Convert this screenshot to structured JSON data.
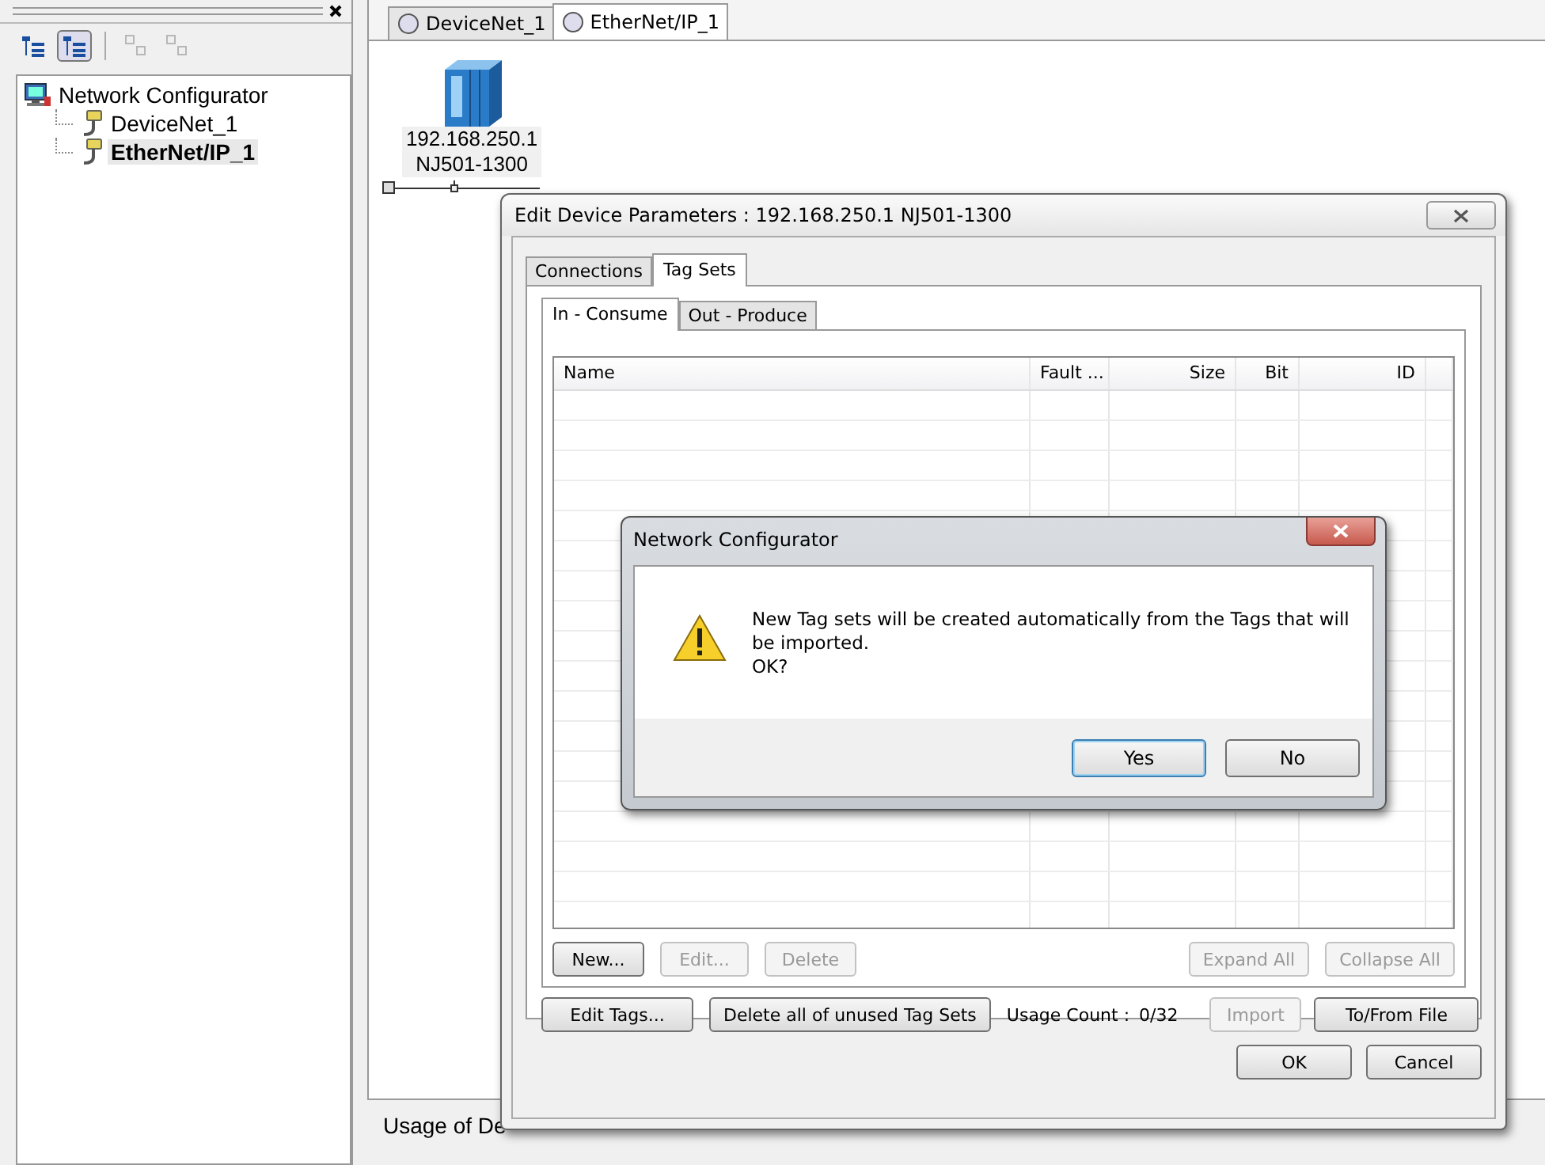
{
  "sidebar": {
    "toolbar": [
      {
        "kind": "tree",
        "pressed": false,
        "disabled": false
      },
      {
        "kind": "tree",
        "pressed": true,
        "disabled": false
      },
      {
        "kind": "expand",
        "pressed": false,
        "disabled": true
      },
      {
        "kind": "collapse",
        "pressed": false,
        "disabled": true
      }
    ],
    "tree": [
      {
        "label": "Network Configurator",
        "kind": "pc",
        "selected": false,
        "children": [
          {
            "label": "DeviceNet_1",
            "kind": "network",
            "selected": false
          },
          {
            "label": "EtherNet/IP_1",
            "kind": "network",
            "selected": true
          }
        ]
      }
    ]
  },
  "doc_tabs": [
    {
      "label": "DeviceNet_1",
      "selected": false
    },
    {
      "label": "EtherNet/IP_1",
      "selected": true
    }
  ],
  "device": {
    "ip": "192.168.250.1",
    "model": "NJ501-1300"
  },
  "bottom_panel": {
    "title": "Usage of De"
  },
  "edit_dialog": {
    "title": "Edit Device Parameters : 192.168.250.1 NJ501-1300",
    "tabs": [
      {
        "label": "Connections",
        "selected": false
      },
      {
        "label": "Tag Sets",
        "selected": true
      }
    ],
    "subtabs": [
      {
        "label": "In - Consume",
        "selected": true
      },
      {
        "label": "Out - Produce",
        "selected": false
      }
    ],
    "columns": [
      "Name",
      "Fault ...",
      "Size",
      "Bit",
      "ID"
    ],
    "table_buttons": [
      {
        "label": "New...",
        "disabled": false
      },
      {
        "label": "Edit...",
        "disabled": true
      },
      {
        "label": "Delete",
        "disabled": true
      },
      {
        "label": "Expand All",
        "disabled": true
      },
      {
        "label": "Collapse All",
        "disabled": true
      }
    ],
    "bottom_buttons": [
      {
        "label": "Edit Tags...",
        "disabled": false
      },
      {
        "label": "Delete all of unused Tag Sets",
        "disabled": false
      },
      {
        "label": "Import",
        "disabled": true
      },
      {
        "label": "To/From File",
        "disabled": false
      }
    ],
    "usage_label": "Usage Count :",
    "usage_value": "0/32",
    "footer_buttons": [
      "OK",
      "Cancel"
    ]
  },
  "message_box": {
    "title": "Network Configurator",
    "message": "New Tag sets will be created automatically from the Tags that will be imported.",
    "question": "OK?",
    "buttons": [
      {
        "label": "Yes",
        "default": true
      },
      {
        "label": "No",
        "default": false
      }
    ]
  }
}
